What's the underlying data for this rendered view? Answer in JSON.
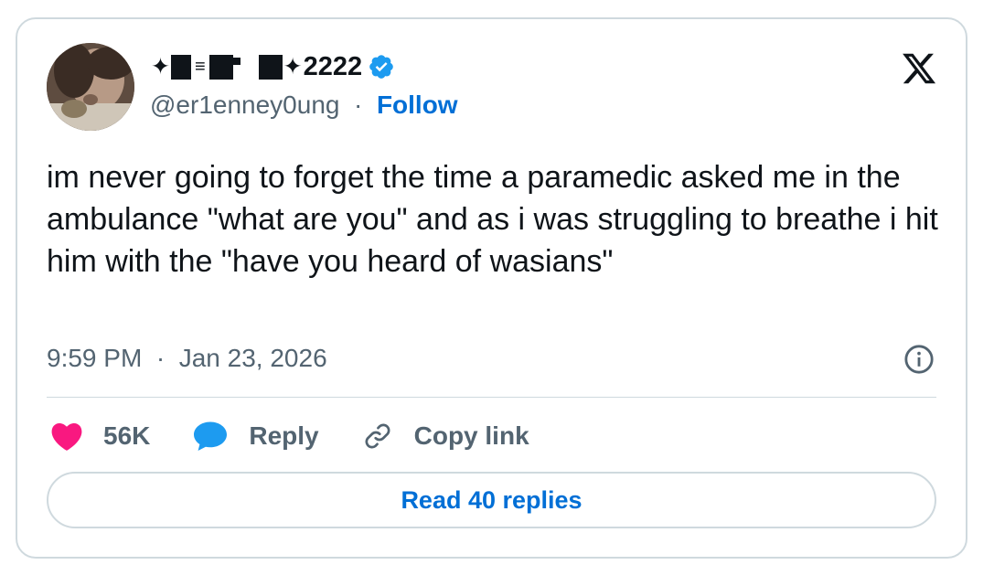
{
  "author": {
    "display_name_suffix": "2222",
    "handle": "@er1enney0ung",
    "separator": "·",
    "follow_label": "Follow"
  },
  "tweet": {
    "text": "im never going to forget the time a paramedic asked me in the ambulance \"what are you\" and as i was struggling to breathe i hit him with the \"have you heard of wasians\"",
    "time": "9:59 PM",
    "separator": "·",
    "date": "Jan 23, 2026"
  },
  "actions": {
    "likes_count": "56K",
    "reply_label": "Reply",
    "copy_link_label": "Copy link"
  },
  "read_replies_label": "Read 40 replies",
  "colors": {
    "accent": "#006fd6",
    "verified": "#1d9bf0",
    "like": "#f91880",
    "reply": "#1d9bf0",
    "border": "#cfd9de",
    "muted_text": "#536471",
    "text": "#0f1419"
  },
  "icons": [
    "verified-badge-icon",
    "x-logo-icon",
    "info-icon",
    "heart-icon",
    "reply-bubble-icon",
    "link-icon"
  ]
}
